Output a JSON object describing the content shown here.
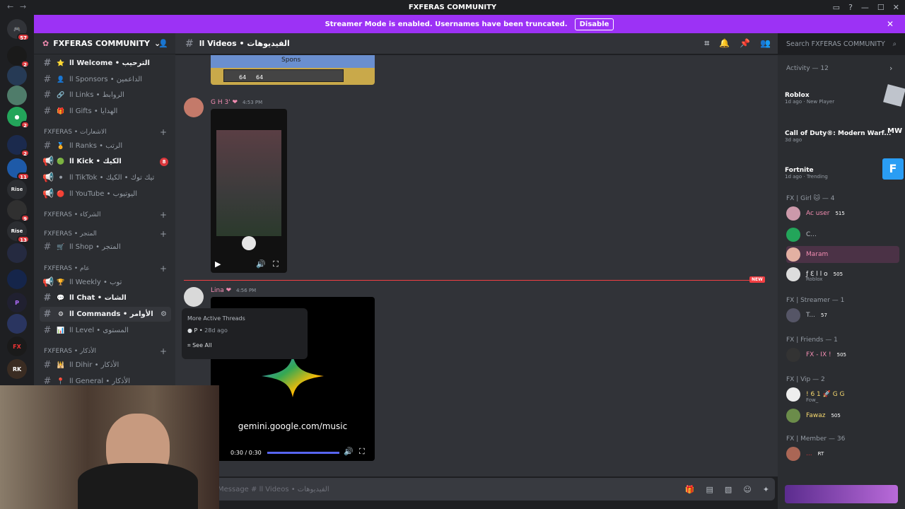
{
  "window": {
    "title": "FXFERAS COMMUNITY",
    "nav_back": "←",
    "nav_forward": "→"
  },
  "banner": {
    "text": "Streamer Mode is enabled. Usernames have been truncated.",
    "button": "Disable",
    "close": "✕"
  },
  "server": {
    "name": "FXFERAS COMMUNITY"
  },
  "channels": [
    {
      "name": "ll Welcome • الترحيب",
      "icon": "⭐",
      "unread": true
    },
    {
      "name": "ll Sponsors • الداعمين",
      "icon": "👤",
      "unread": false
    },
    {
      "name": "ll Links • الروابط",
      "icon": "🔗",
      "unread": false
    },
    {
      "name": "ll Gifts • الهدايا",
      "icon": "🎁",
      "unread": false
    }
  ],
  "cat1": {
    "name": "FXFERAS • الاشعارات"
  },
  "channels2": [
    {
      "name": "ll Ranks • الرتب",
      "icon": "🏅",
      "unread": false
    },
    {
      "name": "ll Kick • الكيك",
      "icon": "🟢",
      "unread": true,
      "badge": "8"
    },
    {
      "name": "ll TikTok • تيك توك • الكيك",
      "icon": "⚫",
      "unread": false
    },
    {
      "name": "ll YouTube • اليوتيوب",
      "icon": "🔴",
      "unread": false
    }
  ],
  "cat2": {
    "name": "FXFERAS • الشركاء"
  },
  "cat3": {
    "name": "FXFERAS • المتجر"
  },
  "channels3": [
    {
      "name": "ll Shop • المتجر",
      "icon": "🛒",
      "unread": false
    }
  ],
  "cat4": {
    "name": "FXFERAS • عام"
  },
  "channels4": [
    {
      "name": "ll Weekly • توب",
      "icon": "🏆",
      "unread": false
    },
    {
      "name": "ll Chat • الشات",
      "icon": "💬",
      "unread": true
    },
    {
      "name": "ll Commands • الأوامر",
      "icon": "⚙",
      "unread": true
    },
    {
      "name": "ll Level • المستوى",
      "icon": "📊",
      "unread": false
    }
  ],
  "cat5": {
    "name": "FXFERAS • الأذكار"
  },
  "channels5": [
    {
      "name": "ll Dihir • الأذكار",
      "icon": "🕌",
      "unread": false
    },
    {
      "name": "ll General • الأذكار",
      "icon": "📍",
      "unread": false
    }
  ],
  "header": {
    "channel": "ll Videos • الفيديوهات",
    "search_placeholder": "Search FXFERAS COMMUNITY"
  },
  "messages": [
    {
      "author": "G H 3'",
      "time": "4:53 PM"
    },
    {
      "author": "Lina",
      "time": "4:56 PM"
    }
  ],
  "embed_top": {
    "label": "Spons",
    "num1": "64",
    "num2": "64"
  },
  "video2": {
    "caption": "gemini.google.com/music",
    "time": "0:30 / 0:30"
  },
  "new_label": "NEW",
  "popover": {
    "title": "More Active Threads",
    "thread_user": "P",
    "thread_age": "28d ago",
    "see_all": "See All"
  },
  "composer": {
    "placeholder": "Message # ll Videos • الفيديوهات"
  },
  "activity": {
    "title": "Activity — 12",
    "items": [
      {
        "game": "Roblox",
        "age": "1d ago",
        "tag": "New Player"
      },
      {
        "game": "Call of Duty®: Modern Warf...",
        "age": "3d ago",
        "tag": ""
      },
      {
        "game": "Fortnite",
        "age": "1d ago",
        "tag": "Trending"
      }
    ]
  },
  "roles": [
    {
      "title": "FX | Girl 🐱 — 4",
      "members": [
        {
          "name": "Ac user",
          "extra": "515"
        },
        {
          "name": "C...",
          "extra": ""
        },
        {
          "name": "Maram",
          "extra": ""
        },
        {
          "name": "ƒ Ɛ l l o",
          "extra": "505",
          "sub": "Roblox"
        }
      ]
    },
    {
      "title": "FX | Streamer — 1",
      "members": [
        {
          "name": "T...",
          "extra": "57"
        }
      ]
    },
    {
      "title": "FX | Friends — 1",
      "members": [
        {
          "name": "FX - IX !",
          "extra": "505"
        }
      ]
    },
    {
      "title": "FX | Vip — 2",
      "members": [
        {
          "name": "! 6 1 🚀 G G",
          "extra": "",
          "sub": "Fow_"
        },
        {
          "name": "Fawaz",
          "extra": "505"
        }
      ]
    },
    {
      "title": "FX | Member — 36",
      "members": [
        {
          "name": "...",
          "extra": "RT"
        }
      ]
    }
  ],
  "server_badges": [
    "57",
    "2",
    "2",
    "2",
    "2",
    "11",
    "9",
    "13"
  ]
}
